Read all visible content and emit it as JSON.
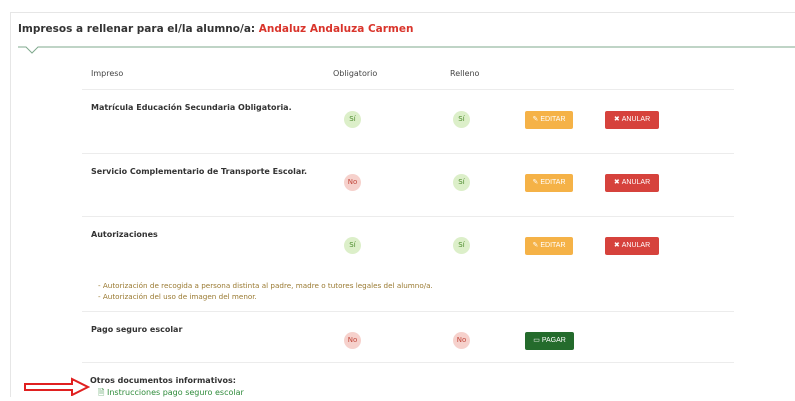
{
  "header": {
    "title_prefix": "Impresos a rellenar para el/la alumno/a:",
    "student_name": "Andaluz Andaluza Carmen"
  },
  "table": {
    "columns": [
      "Impreso",
      "Obligatorio",
      "Relleno"
    ],
    "rows": [
      {
        "title": "Matrícula Educación Secundaria Obligatoria.",
        "obligatorio": "Sí",
        "relleno": "Sí",
        "edit_label": "EDITAR",
        "cancel_label": "ANULAR"
      },
      {
        "title": "Servicio Complementario de Transporte Escolar.",
        "obligatorio": "No",
        "relleno": "Sí",
        "edit_label": "EDITAR",
        "cancel_label": "ANULAR"
      },
      {
        "title": "Autorizaciones",
        "obligatorio": "Sí",
        "relleno": "Sí",
        "edit_label": "EDITAR",
        "cancel_label": "ANULAR",
        "notes": [
          "- Autorización de recogida a persona distinta al padre, madre o tutores legales del alumno/a.",
          "- Autorización del uso de imagen del menor."
        ]
      },
      {
        "title": "Pago seguro escolar",
        "obligatorio": "No",
        "relleno": "No",
        "pay_label": "PAGAR"
      }
    ]
  },
  "other_docs": {
    "title": "Otros documentos informativos:",
    "link_label": "Instrucciones pago seguro escolar"
  },
  "colors": {
    "student_name": "#d9342b",
    "yes_bg": "#dcefc9",
    "no_bg": "#f6d1cc",
    "edit_button": "#f5b247",
    "cancel_button": "#d6423c",
    "pay_button": "#246b2c",
    "arrow": "#e02020"
  },
  "icons": {
    "edit": "pencil-icon",
    "cancel": "times-icon",
    "pay": "credit-card-icon",
    "doc": "file-icon",
    "pointer": "arrow-right-icon"
  }
}
